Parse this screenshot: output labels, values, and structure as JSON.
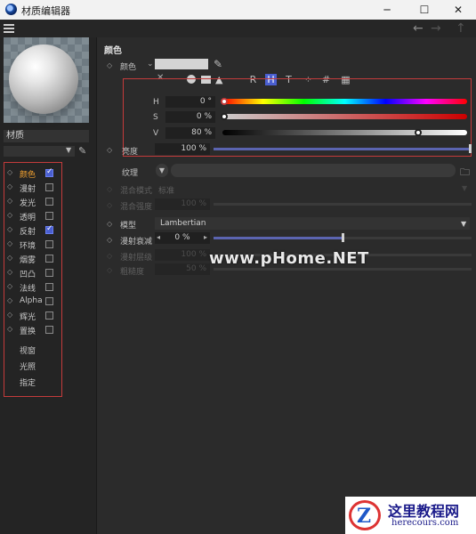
{
  "window": {
    "title": "材质编辑器",
    "minimize": "─",
    "maximize": "☐",
    "close": "✕"
  },
  "toolbar": {
    "back": "←",
    "forward": "→",
    "up": "↑"
  },
  "left": {
    "material_name": "材质",
    "channels": [
      {
        "label": "颜色",
        "checked": true,
        "active": true,
        "checkbox": true,
        "marker": true
      },
      {
        "label": "漫射",
        "checked": false,
        "active": false,
        "checkbox": true,
        "marker": true
      },
      {
        "label": "发光",
        "checked": false,
        "active": false,
        "checkbox": true,
        "marker": true
      },
      {
        "label": "透明",
        "checked": false,
        "active": false,
        "checkbox": true,
        "marker": true
      },
      {
        "label": "反射",
        "checked": true,
        "active": false,
        "checkbox": true,
        "marker": true
      },
      {
        "label": "环境",
        "checked": false,
        "active": false,
        "checkbox": true,
        "marker": true
      },
      {
        "label": "烟雾",
        "checked": false,
        "active": false,
        "checkbox": true,
        "marker": true
      },
      {
        "label": "凹凸",
        "checked": false,
        "active": false,
        "checkbox": true,
        "marker": true
      },
      {
        "label": "法线",
        "checked": false,
        "active": false,
        "checkbox": true,
        "marker": true
      },
      {
        "label": "Alpha",
        "checked": false,
        "active": false,
        "checkbox": true,
        "marker": true
      },
      {
        "label": "辉光",
        "checked": false,
        "active": false,
        "checkbox": true,
        "marker": true
      },
      {
        "label": "置换",
        "checked": false,
        "active": false,
        "checkbox": true,
        "marker": true
      },
      {
        "label": "视窗",
        "checked": false,
        "active": false,
        "checkbox": false,
        "marker": false
      },
      {
        "label": "光照",
        "checked": false,
        "active": false,
        "checkbox": false,
        "marker": false
      },
      {
        "label": "指定",
        "checked": false,
        "active": false,
        "checkbox": false,
        "marker": false
      }
    ]
  },
  "color_section": {
    "title": "颜色",
    "color_label": "颜色",
    "swatch_color": "#d4d4d4",
    "mode_buttons": [
      "R",
      "H",
      "T",
      "⁘",
      "#",
      "▦"
    ],
    "active_mode": "H",
    "h_label": "H",
    "h_value": "0 °",
    "h_fraction": 0.0,
    "s_label": "S",
    "s_value": "0 %",
    "s_fraction": 0.0,
    "v_label": "V",
    "v_value": "80 %",
    "v_fraction": 0.8,
    "brightness_label": "亮度",
    "brightness_value": "100 %",
    "brightness_fraction": 1.0
  },
  "texture_section": {
    "texture_label": "纹理",
    "blend_mode_label": "混合模式",
    "blend_mode_value": "标准",
    "blend_strength_label": "混合强度",
    "blend_strength_value": "100 %"
  },
  "diffuse_section": {
    "model_label": "模型",
    "model_value": "Lambertian",
    "falloff_label": "漫射衰减",
    "falloff_value": "0 %",
    "falloff_fraction": 0.5,
    "level_label": "漫射层级",
    "level_value": "100 %",
    "roughness_label": "粗糙度",
    "roughness_value": "50 %"
  },
  "watermark": "www.pHome.NET",
  "logo": {
    "mark": "Z",
    "cn": "这里教程网",
    "en": "herecours.com"
  },
  "colors": {
    "accent": "#4a5fd0",
    "highlight_border": "#c43b3b",
    "active_channel": "#f0a030"
  }
}
